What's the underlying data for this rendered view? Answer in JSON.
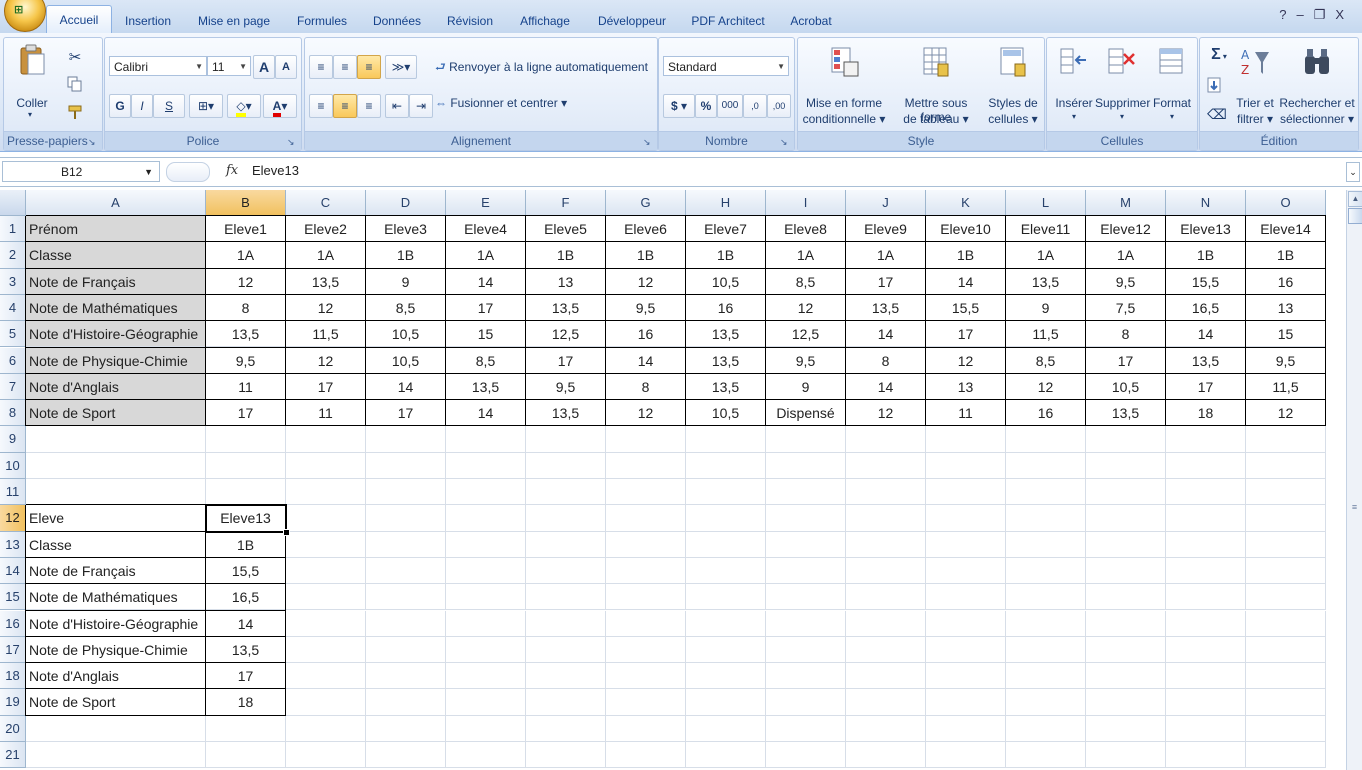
{
  "office_button": {
    "glyph": "⊞"
  },
  "tabs": [
    "Accueil",
    "Insertion",
    "Mise en page",
    "Formules",
    "Données",
    "Révision",
    "Affichage",
    "Développeur",
    "PDF Architect",
    "Acrobat"
  ],
  "active_tab": "Accueil",
  "window_controls": {
    "help": "?",
    "minimize": "–",
    "restore": "❐",
    "close": "X"
  },
  "ribbon": {
    "clipboard": {
      "label": "Presse-papiers",
      "paste": "Coller"
    },
    "font": {
      "label": "Police",
      "font_name": "Calibri",
      "font_size": "11",
      "grow": "A",
      "shrink": "A",
      "bold": "G",
      "italic": "I",
      "underline": "S",
      "font_color": "A"
    },
    "alignment": {
      "label": "Alignement",
      "wrap_text": "Renvoyer à la ligne automatiquement",
      "merge_center": "Fusionner et centrer"
    },
    "number": {
      "label": "Nombre",
      "format": "Standard",
      "currency": "$",
      "percent": "%",
      "thousands": "000",
      "inc_decimal": ",0",
      "dec_decimal": ",00"
    },
    "style": {
      "label": "Style",
      "conditional": "Mise en forme conditionnelle",
      "conditional_l1": "Mise en forme",
      "conditional_l2": "conditionnelle",
      "table_l1": "Mettre sous forme",
      "table_l2": "de tableau",
      "cell_styles_l1": "Styles de",
      "cell_styles_l2": "cellules"
    },
    "cells": {
      "label": "Cellules",
      "insert": "Insérer",
      "delete": "Supprimer",
      "format": "Format"
    },
    "editing": {
      "label": "Édition",
      "sum": "Σ",
      "sort_l1": "Trier et",
      "sort_l2": "filtrer",
      "find_l1": "Rechercher et",
      "find_l2": "sélectionner"
    }
  },
  "formula_bar": {
    "name_box": "B12",
    "fx": "fx",
    "value": "Eleve13"
  },
  "columns": [
    "A",
    "B",
    "C",
    "D",
    "E",
    "F",
    "G",
    "H",
    "I",
    "J",
    "K",
    "L",
    "M",
    "N",
    "O"
  ],
  "selected_column": "B",
  "selected_row": 12,
  "rows": [
    [
      "Prénom",
      "Eleve1",
      "Eleve2",
      "Eleve3",
      "Eleve4",
      "Eleve5",
      "Eleve6",
      "Eleve7",
      "Eleve8",
      "Eleve9",
      "Eleve10",
      "Eleve11",
      "Eleve12",
      "Eleve13",
      "Eleve14"
    ],
    [
      "Classe",
      "1A",
      "1A",
      "1B",
      "1A",
      "1B",
      "1B",
      "1B",
      "1A",
      "1A",
      "1B",
      "1A",
      "1A",
      "1B",
      "1B"
    ],
    [
      "Note de Français",
      "12",
      "13,5",
      "9",
      "14",
      "13",
      "12",
      "10,5",
      "8,5",
      "17",
      "14",
      "13,5",
      "9,5",
      "15,5",
      "16"
    ],
    [
      "Note de Mathématiques",
      "8",
      "12",
      "8,5",
      "17",
      "13,5",
      "9,5",
      "16",
      "12",
      "13,5",
      "15,5",
      "9",
      "7,5",
      "16,5",
      "13"
    ],
    [
      "Note d'Histoire-Géographie",
      "13,5",
      "11,5",
      "10,5",
      "15",
      "12,5",
      "16",
      "13,5",
      "12,5",
      "14",
      "17",
      "11,5",
      "8",
      "14",
      "15"
    ],
    [
      "Note de Physique-Chimie",
      "9,5",
      "12",
      "10,5",
      "8,5",
      "17",
      "14",
      "13,5",
      "9,5",
      "8",
      "12",
      "8,5",
      "17",
      "13,5",
      "9,5"
    ],
    [
      "Note d'Anglais",
      "11",
      "17",
      "14",
      "13,5",
      "9,5",
      "8",
      "13,5",
      "9",
      "14",
      "13",
      "12",
      "10,5",
      "17",
      "11,5"
    ],
    [
      "Note de Sport",
      "17",
      "11",
      "17",
      "14",
      "13,5",
      "12",
      "10,5",
      "Dispensé",
      "12",
      "11",
      "16",
      "13,5",
      "18",
      "12"
    ],
    [],
    [],
    [],
    [
      "Eleve",
      "Eleve13"
    ],
    [
      "Classe",
      "1B"
    ],
    [
      "Note de Français",
      "15,5"
    ],
    [
      "Note de Mathématiques",
      "16,5"
    ],
    [
      "Note d'Histoire-Géographie",
      "14"
    ],
    [
      "Note de Physique-Chimie",
      "13,5"
    ],
    [
      "Note d'Anglais",
      "17"
    ],
    [
      "Note de Sport",
      "18"
    ],
    [],
    []
  ]
}
